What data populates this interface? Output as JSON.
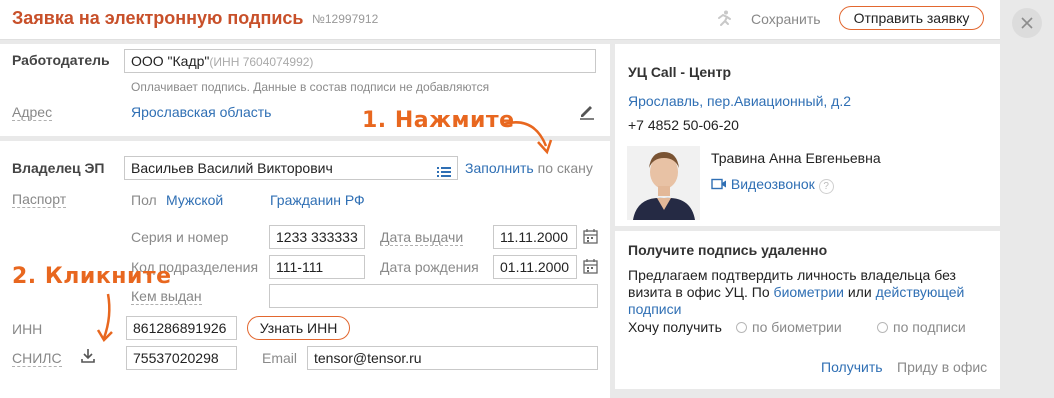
{
  "header": {
    "title": "Заявка на электронную подпись",
    "number": "№12997912",
    "save_label": "Сохранить",
    "send_label": "Отправить заявку"
  },
  "employer": {
    "label": "Работодатель",
    "name": "ООО \"Кадр\"",
    "inn_note": "(ИНН 7604074992)",
    "hint": "Оплачивает подпись. Данные в состав подписи не добавляются",
    "address_label": "Адрес",
    "address_value": "Ярославская область"
  },
  "owner": {
    "label": "Владелец ЭП",
    "name": "Васильев Василий Викторович",
    "fill_label": "Заполнить",
    "fill_suffix": "по скану",
    "passport_label": "Паспорт",
    "sex_label": "Пол",
    "sex_value": "Мужской",
    "citizenship": "Гражданин РФ",
    "series_label": "Серия и номер",
    "series_value": "1233 333333",
    "issue_date_label": "Дата выдачи",
    "issue_date_value": "11.11.2000",
    "dept_code_label": "Код подразделения",
    "dept_code_value": "111-111",
    "birth_date_label": "Дата рождения",
    "birth_date_value": "01.11.2000",
    "issued_by_label": "Кем выдан",
    "issued_by_value": "",
    "inn_label": "ИНН",
    "inn_value": "861286891926",
    "inn_button": "Узнать ИНН",
    "snils_label": "СНИЛС",
    "snils_value": "75537020298",
    "email_label": "Email",
    "email_value": "tensor@tensor.ru"
  },
  "annotations": {
    "step1": "1. Нажмите",
    "step2": "2. Кликните"
  },
  "center": {
    "title": "УЦ Call - Центр",
    "address": "Ярославль, пер.Авиационный, д.2",
    "phone": "+7 4852 50-06-20",
    "manager": "Травина Анна Евгеньевна",
    "video_call": "Видеозвонок"
  },
  "remote": {
    "title": "Получите подпись удаленно",
    "text_before": "Предлагаем подтвердить личность владельца без визита в офис УЦ. По ",
    "link_biometry": "биометрии",
    "text_or": " или ",
    "link_signature": "действующей подписи",
    "want_label": "Хочу получить",
    "option1": "по биометрии",
    "option2": "по подписи",
    "get_label": "Получить",
    "office_label": "Приду в офис"
  },
  "colors": {
    "accent": "#e2672f",
    "title": "#c8502a",
    "link": "#2f6fb4"
  }
}
